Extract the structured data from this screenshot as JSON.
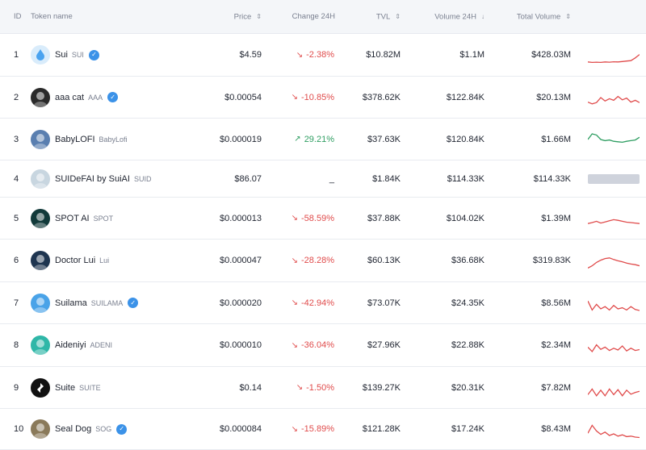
{
  "header": {
    "id": "ID",
    "token_name": "Token name",
    "price": "Price",
    "change": "Change 24H",
    "tvl": "TVL",
    "volume": "Volume 24H",
    "total_volume": "Total Volume"
  },
  "rows": [
    {
      "id": "1",
      "name": "Sui",
      "symbol": "SUI",
      "verified": true,
      "price": "$4.59",
      "change": "-2.38%",
      "direction": "down",
      "tvl": "$10.82M",
      "volume": "$1.1M",
      "total_volume": "$428.03M",
      "avatar_color": "#d9ecfb",
      "icon": "droplet-icon"
    },
    {
      "id": "2",
      "name": "aaa cat",
      "symbol": "AAA",
      "verified": true,
      "price": "$0.00054",
      "change": "-10.85%",
      "direction": "down",
      "tvl": "$378.62K",
      "volume": "$122.84K",
      "total_volume": "$20.13M",
      "avatar_color": "#2a2a2a",
      "icon": "cat-avatar-icon"
    },
    {
      "id": "3",
      "name": "BabyLOFI",
      "symbol": "BabyLofi",
      "verified": false,
      "price": "$0.000019",
      "change": "29.21%",
      "direction": "up",
      "tvl": "$37.63K",
      "volume": "$120.84K",
      "total_volume": "$1.66M",
      "avatar_color": "#5a7fb0",
      "icon": "baby-lofi-avatar-icon"
    },
    {
      "id": "4",
      "name": "SUIDeFAI by SuiAI",
      "symbol": "SUID",
      "verified": false,
      "price": "$86.07",
      "change": "_",
      "direction": "none",
      "tvl": "$1.84K",
      "volume": "$114.33K",
      "total_volume": "$114.33K",
      "avatar_color": "#c8d6e0",
      "icon": "robot-avatar-icon"
    },
    {
      "id": "5",
      "name": "SPOT AI",
      "symbol": "SPOT",
      "verified": false,
      "price": "$0.000013",
      "change": "-58.59%",
      "direction": "down",
      "tvl": "$37.88K",
      "volume": "$104.02K",
      "total_volume": "$1.39M",
      "avatar_color": "#123a3a",
      "icon": "spot-avatar-icon"
    },
    {
      "id": "6",
      "name": "Doctor Lui",
      "symbol": "Lui",
      "verified": false,
      "price": "$0.000047",
      "change": "-28.28%",
      "direction": "down",
      "tvl": "$60.13K",
      "volume": "$36.68K",
      "total_volume": "$319.83K",
      "avatar_color": "#1e3550",
      "icon": "doctor-avatar-icon"
    },
    {
      "id": "7",
      "name": "Suilama",
      "symbol": "SUILAMA",
      "verified": true,
      "price": "$0.000020",
      "change": "-42.94%",
      "direction": "down",
      "tvl": "$73.07K",
      "volume": "$24.35K",
      "total_volume": "$8.56M",
      "avatar_color": "#4aa3e8",
      "icon": "llama-avatar-icon"
    },
    {
      "id": "8",
      "name": "Aideniyi",
      "symbol": "ADENI",
      "verified": false,
      "price": "$0.000010",
      "change": "-36.04%",
      "direction": "down",
      "tvl": "$27.96K",
      "volume": "$22.88K",
      "total_volume": "$2.34M",
      "avatar_color": "#2fb7a8",
      "icon": "aideniyi-avatar-icon"
    },
    {
      "id": "9",
      "name": "Suite",
      "symbol": "SUITE",
      "verified": false,
      "price": "$0.14",
      "change": "-1.50%",
      "direction": "down",
      "tvl": "$139.27K",
      "volume": "$20.31K",
      "total_volume": "$7.82M",
      "avatar_color": "#111111",
      "icon": "suite-logo-icon"
    },
    {
      "id": "10",
      "name": "Seal Dog",
      "symbol": "SOG",
      "verified": true,
      "price": "$0.000084",
      "change": "-15.89%",
      "direction": "down",
      "tvl": "$121.28K",
      "volume": "$17.24K",
      "total_volume": "$8.43M",
      "avatar_color": "#8a7a5a",
      "icon": "seal-dog-avatar-icon"
    }
  ],
  "sparklines": [
    [
      0.78,
      0.8,
      0.79,
      0.8,
      0.78,
      0.79,
      0.77,
      0.78,
      0.76,
      0.74,
      0.72,
      0.6,
      0.45
    ],
    [
      0.7,
      0.78,
      0.72,
      0.5,
      0.65,
      0.55,
      0.62,
      0.45,
      0.6,
      0.52,
      0.7,
      0.62,
      0.72
    ],
    [
      0.5,
      0.25,
      0.3,
      0.5,
      0.55,
      0.52,
      0.58,
      0.6,
      0.62,
      0.58,
      0.55,
      0.52,
      0.4
    ],
    [],
    [
      0.72,
      0.68,
      0.62,
      0.7,
      0.65,
      0.6,
      0.55,
      0.58,
      0.62,
      0.66,
      0.68,
      0.7,
      0.72
    ],
    [
      0.8,
      0.7,
      0.55,
      0.45,
      0.38,
      0.35,
      0.42,
      0.48,
      0.52,
      0.58,
      0.62,
      0.65,
      0.7
    ],
    [
      0.4,
      0.8,
      0.55,
      0.75,
      0.65,
      0.8,
      0.6,
      0.75,
      0.7,
      0.8,
      0.65,
      0.78,
      0.82
    ],
    [
      0.55,
      0.75,
      0.45,
      0.65,
      0.55,
      0.7,
      0.6,
      0.68,
      0.5,
      0.72,
      0.6,
      0.7,
      0.66
    ],
    [
      0.8,
      0.55,
      0.85,
      0.6,
      0.85,
      0.55,
      0.8,
      0.58,
      0.85,
      0.6,
      0.78,
      0.7,
      0.65
    ],
    [
      0.65,
      0.3,
      0.55,
      0.7,
      0.6,
      0.75,
      0.68,
      0.78,
      0.72,
      0.8,
      0.78,
      0.82,
      0.84
    ]
  ],
  "colors": {
    "negative": "#e04b4b",
    "positive": "#2f9e62",
    "verified": "#3b92e8",
    "header_bg": "#f4f6f9",
    "row_border": "#e8ebf0"
  }
}
